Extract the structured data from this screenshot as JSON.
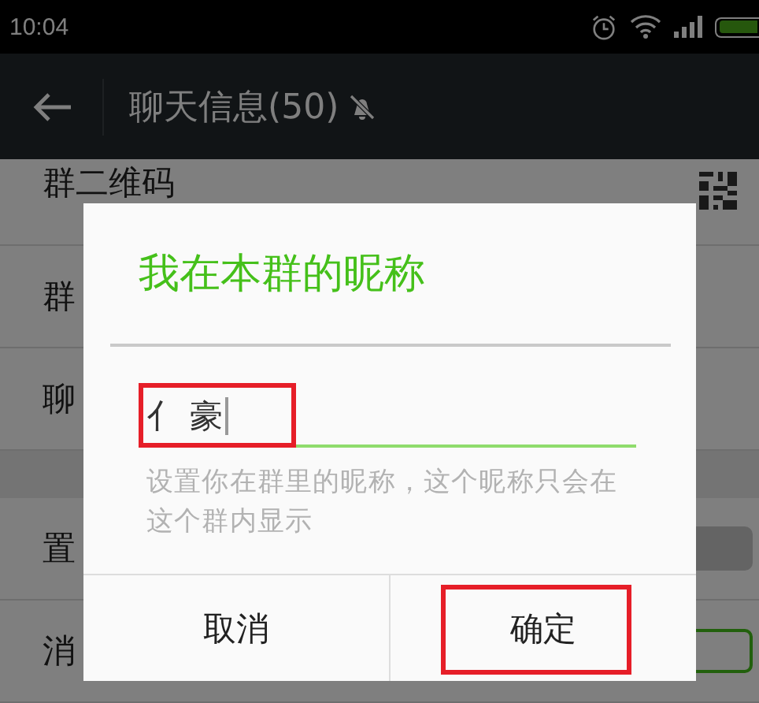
{
  "status_bar": {
    "time": "10:04"
  },
  "toolbar": {
    "title": "聊天信息(50)",
    "muted": true
  },
  "sections": [
    {
      "rows": [
        {
          "label": "群二维码",
          "kind": "qr"
        },
        {
          "label": "群",
          "kind": "plain"
        },
        {
          "label": "聊",
          "kind": "plain"
        }
      ]
    },
    {
      "rows": [
        {
          "label": "置",
          "kind": "switch",
          "on": false
        },
        {
          "label": "消",
          "kind": "switch",
          "on": true
        }
      ]
    }
  ],
  "dialog": {
    "title": "我在本群的昵称",
    "input": {
      "value": "亻 豪",
      "highlighted": true
    },
    "hint": "设置你在群里的昵称，这个昵称只会在这个群内显示",
    "buttons": [
      {
        "label": "取消",
        "highlighted": false
      },
      {
        "label": "确定",
        "highlighted": true
      }
    ]
  }
}
